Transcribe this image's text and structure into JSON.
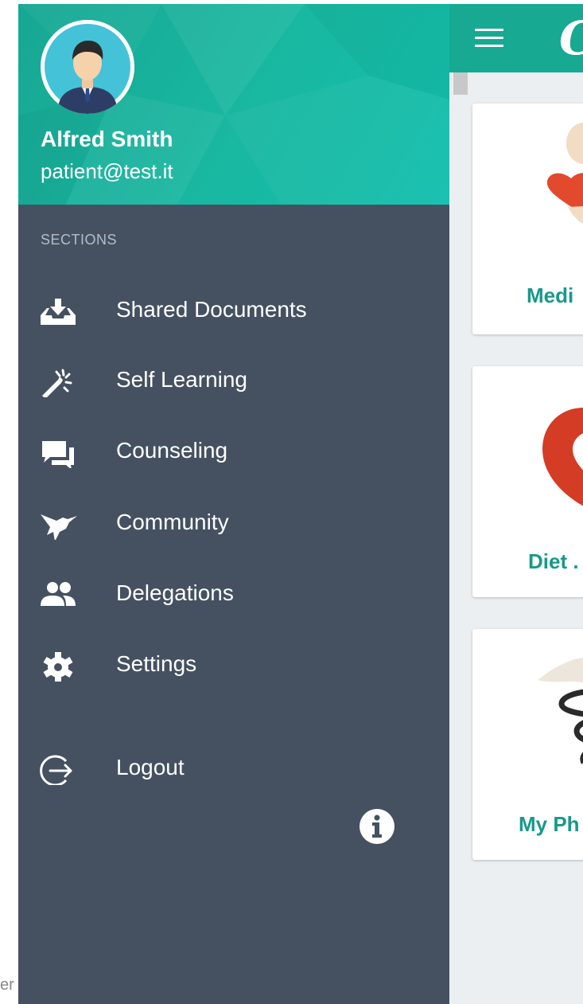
{
  "app": {
    "logo_text": "C",
    "cards": [
      {
        "label": "Medi"
      },
      {
        "label": "Diet ."
      },
      {
        "label": "My Ph"
      }
    ]
  },
  "peek_text": "er",
  "drawer": {
    "user": {
      "name": "Alfred Smith",
      "email": "patient@test.it"
    },
    "section_title": "SECTIONS",
    "items": [
      {
        "label": "Shared Documents",
        "icon": "download-tray-icon"
      },
      {
        "label": "Self Learning",
        "icon": "magic-wand-icon"
      },
      {
        "label": "Counseling",
        "icon": "chat-bubbles-icon"
      },
      {
        "label": "Community",
        "icon": "hummingbird-icon"
      },
      {
        "label": "Delegations",
        "icon": "people-icon"
      },
      {
        "label": "Settings",
        "icon": "gear-icon"
      }
    ],
    "logout_label": "Logout"
  },
  "colors": {
    "drawer_bg": "#455161",
    "header_teal": "#17a991",
    "card_label": "#17998a",
    "content_bg": "#eceff1"
  }
}
